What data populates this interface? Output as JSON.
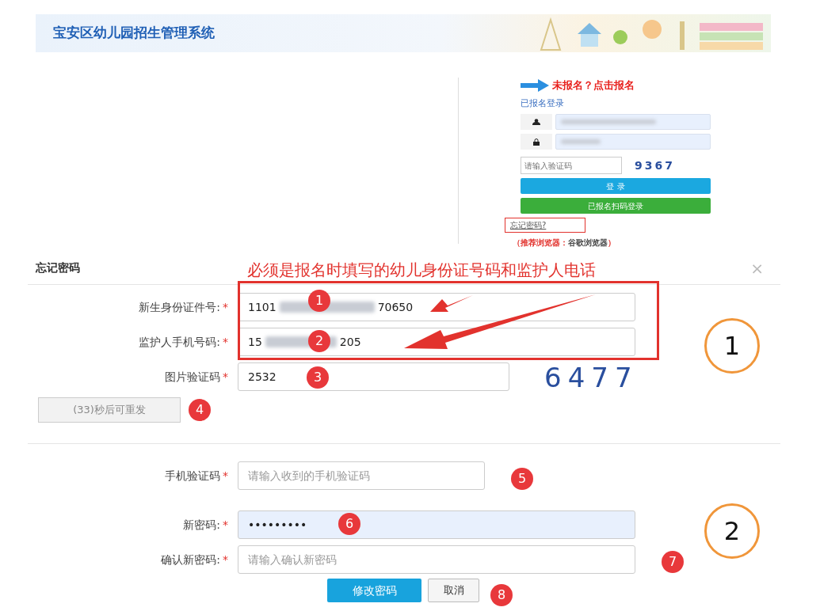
{
  "header": {
    "title": "宝安区幼儿园招生管理系统"
  },
  "login": {
    "register_link": "未报名？点击报名",
    "section_title": "已报名登录",
    "captcha_placeholder": "请输入验证码",
    "captcha_image": "9367",
    "login_button": "登 录",
    "scan_button": "已报名扫码登录",
    "forgot_link": "忘记密码?",
    "browser_note": {
      "prefix": "（推荐浏览器：",
      "browser": "谷歌浏览器",
      "suffix": "）"
    }
  },
  "dialog": {
    "title": "忘记密码",
    "close": "×",
    "fields": [
      {
        "kind": "masked",
        "label": "新生身份证件号:",
        "mark": "*",
        "value_start": "1101",
        "value_end": "70650"
      },
      {
        "kind": "masked",
        "label": "监护人手机号码:",
        "mark": "*",
        "value_start": "15",
        "value_end": "205"
      },
      {
        "kind": "captcha",
        "label": "图片验证码",
        "mark": "*",
        "value": "2532",
        "captcha_image": "6477"
      }
    ],
    "resend_button": "(33)秒后可重发",
    "fields2": [
      {
        "kind": "short",
        "label": "手机验证码",
        "mark": "*",
        "placeholder": "请输入收到的手机验证码",
        "focused": false
      },
      {
        "kind": "password",
        "label": "新密码:",
        "mark": "*",
        "value": "•••••••••",
        "focused": true
      },
      {
        "kind": "wide",
        "label": "确认新密码:",
        "mark": "*",
        "placeholder": "请输入确认新密码",
        "focused": false
      }
    ],
    "submit_button": "修改密码",
    "cancel_button": "取消"
  },
  "annotations": {
    "note": "必须是报名时填写的幼儿身份证号码和监护人电话",
    "markers": [
      "1",
      "2",
      "3",
      "4",
      "5",
      "6",
      "7",
      "8"
    ],
    "circles": [
      "1",
      "2"
    ]
  }
}
